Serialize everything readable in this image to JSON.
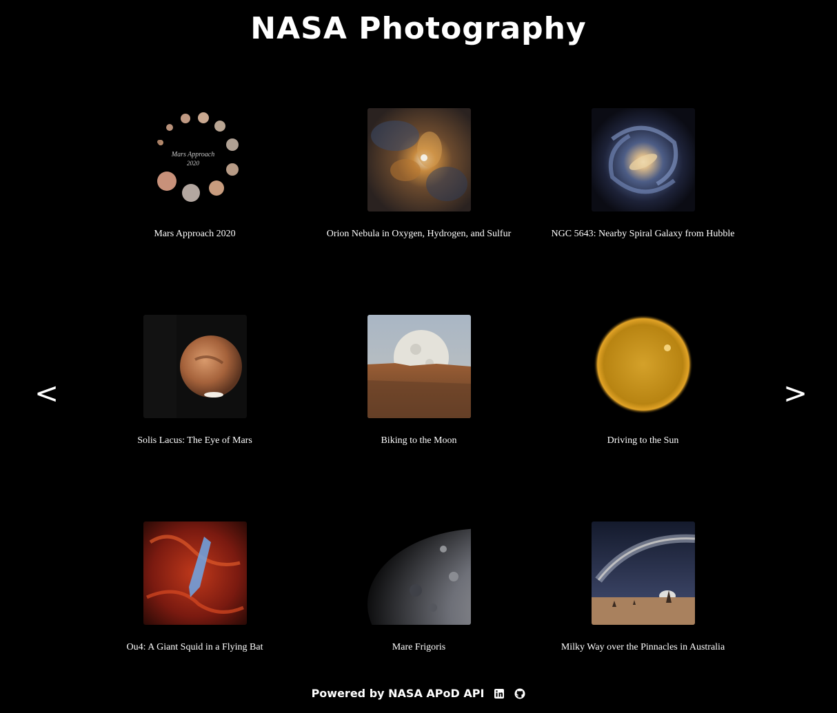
{
  "header": {
    "title": "NASA Photography"
  },
  "nav": {
    "prev_label": "<",
    "next_label": ">"
  },
  "gallery": {
    "items": [
      {
        "title": "Mars Approach 2020",
        "thumb": "mars-approach"
      },
      {
        "title": "Orion Nebula in Oxygen, Hydrogen, and Sulfur",
        "thumb": "orion-nebula"
      },
      {
        "title": "NGC 5643: Nearby Spiral Galaxy from Hubble",
        "thumb": "spiral-galaxy"
      },
      {
        "title": "Solis Lacus: The Eye of Mars",
        "thumb": "mars-planet"
      },
      {
        "title": "Biking to the Moon",
        "thumb": "moon-landscape"
      },
      {
        "title": "Driving to the Sun",
        "thumb": "sun"
      },
      {
        "title": "Ou4: A Giant Squid in a Flying Bat",
        "thumb": "squid-nebula"
      },
      {
        "title": "Mare Frigoris",
        "thumb": "moon-surface"
      },
      {
        "title": "Milky Way over the Pinnacles in Australia",
        "thumb": "milky-way"
      }
    ]
  },
  "footer": {
    "text": "Powered by NASA APoD API",
    "icons": [
      "linkedin-icon",
      "github-icon"
    ]
  }
}
